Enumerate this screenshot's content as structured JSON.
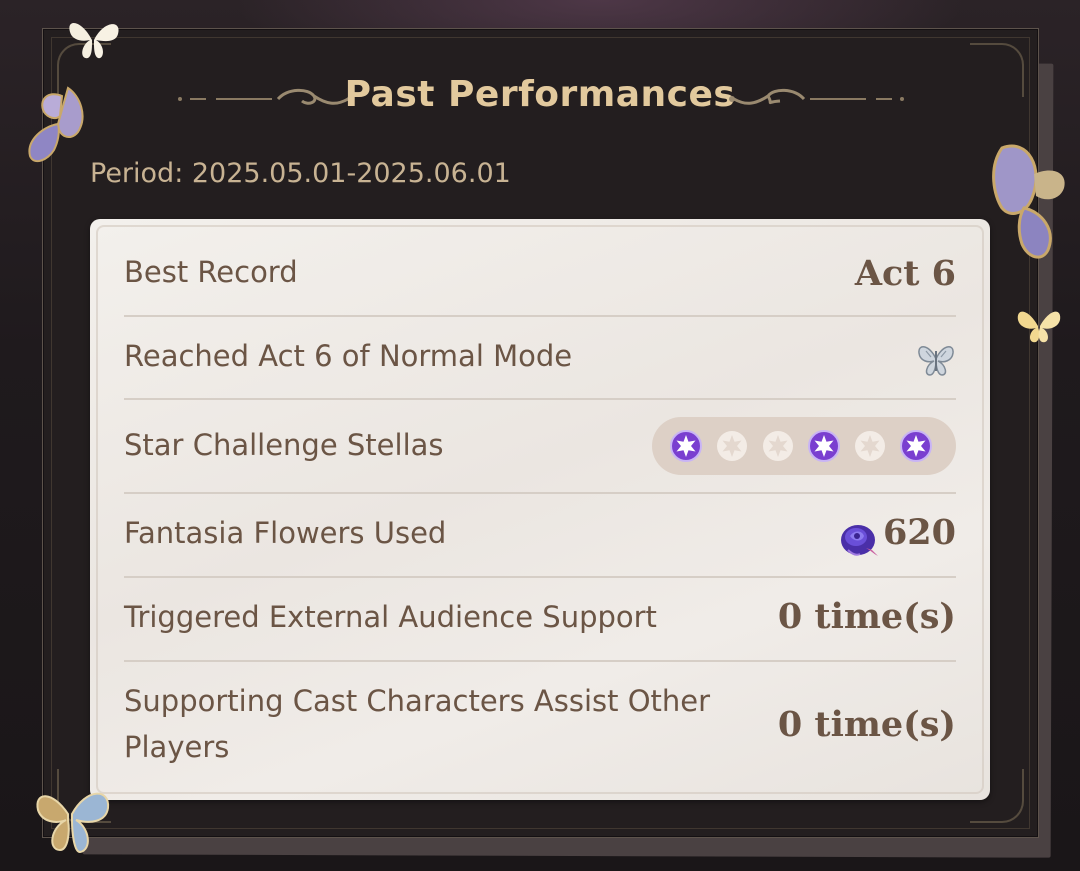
{
  "panel": {
    "title": "Past Performances",
    "period": "Period: 2025.05.01-2025.06.01"
  },
  "rows": [
    {
      "label": "Best Record",
      "value": "Act 6"
    },
    {
      "label": "Reached Act 6 of Normal Mode",
      "icon": "silver-butterfly-icon"
    },
    {
      "label": "Star Challenge Stellas",
      "stellas": [
        true,
        false,
        false,
        true,
        false,
        true
      ]
    },
    {
      "label": "Fantasia Flowers Used",
      "icon": "fantasia-flower-icon",
      "value": "620"
    },
    {
      "label": "Triggered External Audience Support",
      "value": "0 time(s)"
    },
    {
      "label": "Supporting Cast Characters Assist Other Players",
      "value": "0 time(s)"
    }
  ],
  "colors": {
    "title": "#e2c99d",
    "period": "#c8b393",
    "card_text": "#6b5545",
    "stella_filled": "#7a3fd0",
    "stella_empty": "#f3ece6"
  }
}
